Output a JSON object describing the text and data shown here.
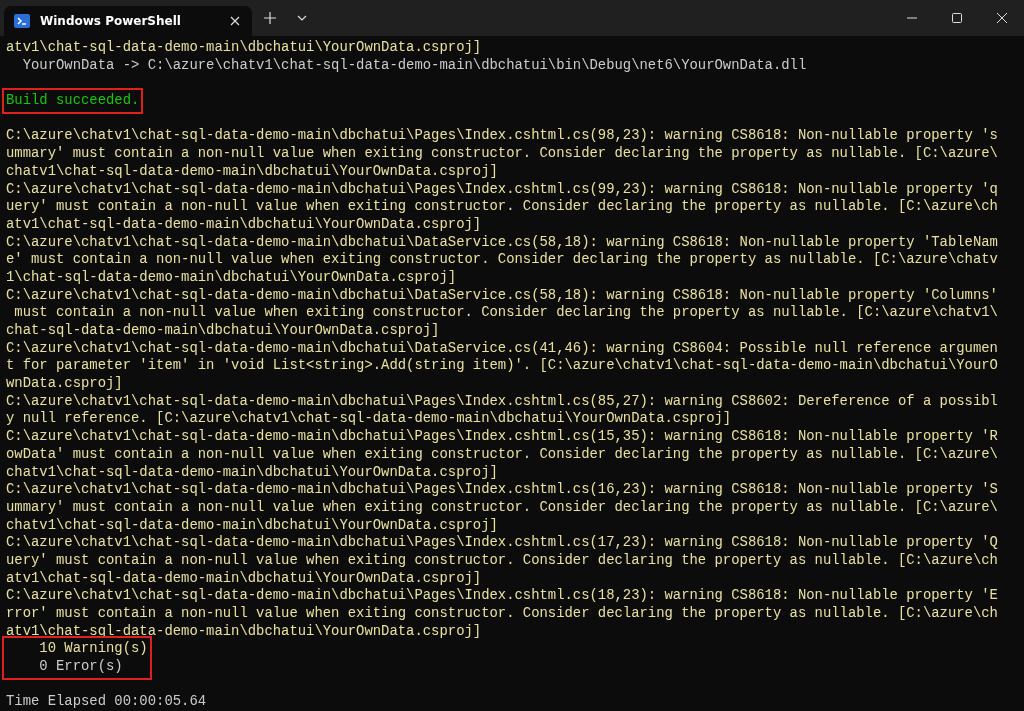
{
  "window": {
    "title": "Windows PowerShell"
  },
  "terminal": {
    "blocks": [
      {
        "highlighted": false,
        "lines": [
          {
            "kind": "warning",
            "text": "atv1\\chat-sql-data-demo-main\\dbchatui\\YourOwnData.csproj]"
          },
          {
            "kind": "plain",
            "text": "  YourOwnData -> C:\\azure\\chatv1\\chat-sql-data-demo-main\\dbchatui\\bin\\Debug\\net6\\YourOwnData.dll"
          },
          {
            "kind": "blank"
          }
        ]
      },
      {
        "highlighted": true,
        "lines": [
          {
            "kind": "success",
            "text": "Build succeeded."
          }
        ]
      },
      {
        "highlighted": false,
        "lines": [
          {
            "kind": "blank"
          },
          {
            "kind": "warning",
            "text": "C:\\azure\\chatv1\\chat-sql-data-demo-main\\dbchatui\\Pages\\Index.cshtml.cs(98,23): warning CS8618: Non-nullable property 's"
          },
          {
            "kind": "warning",
            "text": "ummary' must contain a non-null value when exiting constructor. Consider declaring the property as nullable. [C:\\azure\\"
          },
          {
            "kind": "warning",
            "text": "chatv1\\chat-sql-data-demo-main\\dbchatui\\YourOwnData.csproj]"
          },
          {
            "kind": "warning",
            "text": "C:\\azure\\chatv1\\chat-sql-data-demo-main\\dbchatui\\Pages\\Index.cshtml.cs(99,23): warning CS8618: Non-nullable property 'q"
          },
          {
            "kind": "warning",
            "text": "uery' must contain a non-null value when exiting constructor. Consider declaring the property as nullable. [C:\\azure\\ch"
          },
          {
            "kind": "warning",
            "text": "atv1\\chat-sql-data-demo-main\\dbchatui\\YourOwnData.csproj]"
          },
          {
            "kind": "warning",
            "text": "C:\\azure\\chatv1\\chat-sql-data-demo-main\\dbchatui\\DataService.cs(58,18): warning CS8618: Non-nullable property 'TableNam"
          },
          {
            "kind": "warning",
            "text": "e' must contain a non-null value when exiting constructor. Consider declaring the property as nullable. [C:\\azure\\chatv"
          },
          {
            "kind": "warning",
            "text": "1\\chat-sql-data-demo-main\\dbchatui\\YourOwnData.csproj]"
          },
          {
            "kind": "warning",
            "text": "C:\\azure\\chatv1\\chat-sql-data-demo-main\\dbchatui\\DataService.cs(58,18): warning CS8618: Non-nullable property 'Columns'"
          },
          {
            "kind": "warning",
            "text": " must contain a non-null value when exiting constructor. Consider declaring the property as nullable. [C:\\azure\\chatv1\\"
          },
          {
            "kind": "warning",
            "text": "chat-sql-data-demo-main\\dbchatui\\YourOwnData.csproj]"
          },
          {
            "kind": "warning",
            "text": "C:\\azure\\chatv1\\chat-sql-data-demo-main\\dbchatui\\DataService.cs(41,46): warning CS8604: Possible null reference argumen"
          },
          {
            "kind": "warning",
            "text": "t for parameter 'item' in 'void List<string>.Add(string item)'. [C:\\azure\\chatv1\\chat-sql-data-demo-main\\dbchatui\\YourO"
          },
          {
            "kind": "warning",
            "text": "wnData.csproj]"
          },
          {
            "kind": "warning",
            "text": "C:\\azure\\chatv1\\chat-sql-data-demo-main\\dbchatui\\Pages\\Index.cshtml.cs(85,27): warning CS8602: Dereference of a possibl"
          },
          {
            "kind": "warning",
            "text": "y null reference. [C:\\azure\\chatv1\\chat-sql-data-demo-main\\dbchatui\\YourOwnData.csproj]"
          },
          {
            "kind": "warning",
            "text": "C:\\azure\\chatv1\\chat-sql-data-demo-main\\dbchatui\\Pages\\Index.cshtml.cs(15,35): warning CS8618: Non-nullable property 'R"
          },
          {
            "kind": "warning",
            "text": "owData' must contain a non-null value when exiting constructor. Consider declaring the property as nullable. [C:\\azure\\"
          },
          {
            "kind": "warning",
            "text": "chatv1\\chat-sql-data-demo-main\\dbchatui\\YourOwnData.csproj]"
          },
          {
            "kind": "warning",
            "text": "C:\\azure\\chatv1\\chat-sql-data-demo-main\\dbchatui\\Pages\\Index.cshtml.cs(16,23): warning CS8618: Non-nullable property 'S"
          },
          {
            "kind": "warning",
            "text": "ummary' must contain a non-null value when exiting constructor. Consider declaring the property as nullable. [C:\\azure\\"
          },
          {
            "kind": "warning",
            "text": "chatv1\\chat-sql-data-demo-main\\dbchatui\\YourOwnData.csproj]"
          },
          {
            "kind": "warning",
            "text": "C:\\azure\\chatv1\\chat-sql-data-demo-main\\dbchatui\\Pages\\Index.cshtml.cs(17,23): warning CS8618: Non-nullable property 'Q"
          },
          {
            "kind": "warning",
            "text": "uery' must contain a non-null value when exiting constructor. Consider declaring the property as nullable. [C:\\azure\\ch"
          },
          {
            "kind": "warning",
            "text": "atv1\\chat-sql-data-demo-main\\dbchatui\\YourOwnData.csproj]"
          },
          {
            "kind": "warning",
            "text": "C:\\azure\\chatv1\\chat-sql-data-demo-main\\dbchatui\\Pages\\Index.cshtml.cs(18,23): warning CS8618: Non-nullable property 'E"
          },
          {
            "kind": "warning",
            "text": "rror' must contain a non-null value when exiting constructor. Consider declaring the property as nullable. [C:\\azure\\ch"
          },
          {
            "kind": "warning",
            "text": "atv1\\chat-sql-data-demo-main\\dbchatui\\YourOwnData.csproj]"
          }
        ]
      },
      {
        "highlighted": true,
        "lines": [
          {
            "kind": "warning",
            "text": "    10 Warning(s)"
          },
          {
            "kind": "plain",
            "text": "    0 Error(s)"
          }
        ]
      },
      {
        "highlighted": false,
        "lines": [
          {
            "kind": "blank"
          },
          {
            "kind": "plain",
            "text": "Time Elapsed 00:00:05.64"
          }
        ]
      }
    ]
  }
}
